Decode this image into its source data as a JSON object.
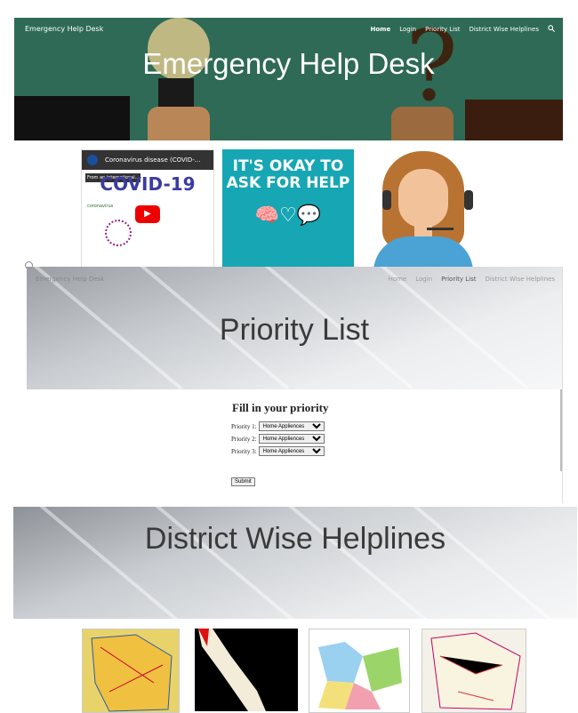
{
  "site": {
    "title": "Emergency Help Desk"
  },
  "nav": {
    "items": [
      "Home",
      "Login",
      "Priority List",
      "District Wise Helplines"
    ],
    "active": "Home",
    "search_icon": "search-icon"
  },
  "hero1": {
    "title": "Emergency Help Desk"
  },
  "cards": {
    "video": {
      "title": "Coronavirus disease (COVID-...",
      "from": "From an international...",
      "heading": "COVID-19",
      "sub": "coronavirus"
    },
    "okay": {
      "text": "IT'S OKAY TO ASK FOR HELP"
    }
  },
  "priority": {
    "hero_title": "Priority List",
    "form_heading": "Fill in your priority",
    "rows": [
      {
        "label": "Priority 1:",
        "value": "Home Appliences"
      },
      {
        "label": "Priority 2:",
        "value": "Home Appliences"
      },
      {
        "label": "Priority 3:",
        "value": "Home Appliences"
      }
    ],
    "submit": "Submit"
  },
  "district": {
    "hero_title": "District Wise Helplines"
  }
}
